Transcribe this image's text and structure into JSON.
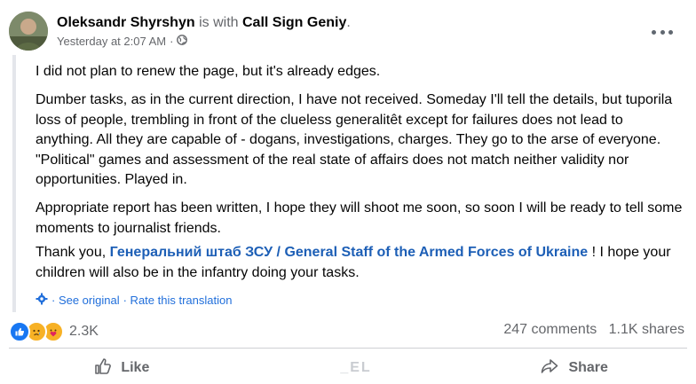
{
  "post": {
    "author": "Oleksandr Shyrshyn",
    "is_with": "is with",
    "tagged": "Call Sign Geniy",
    "period": ".",
    "timestamp": "Yesterday at 2:07 AM",
    "separator": "·",
    "paragraph_1": "I did not plan to renew the page, but it's already edges.",
    "paragraph_2": "Dumber tasks, as in the current direction, I have not received. Someday I'll tell the details, but tuporila loss of people, trembling in front of the clueless generalitêt except for failures does not lead to anything. All they are capable of - dogans, investigations, charges. They go to the arse of everyone. \"Political\" games and assessment of the real state of affairs does not match neither validity nor opportunities. Played in.",
    "paragraph_3": "Appropriate report has been written, I hope they will shoot me soon, so soon I will be ready to tell some moments to journalist friends.",
    "paragraph_4_before": "Thank you, ",
    "paragraph_4_link": "Генеральний штаб ЗСУ / General Staff of the Armed Forces of Ukraine",
    "paragraph_4_after": " ! I hope your children will also be in the infantry doing your tasks.",
    "see_original": "· See original",
    "rate_translation": "· Rate this translation"
  },
  "stats": {
    "reactions_count": "2.3K",
    "comments": "247 comments",
    "shares": "1.1K shares"
  },
  "actions": {
    "like": "Like",
    "center_watermark": " _EL",
    "share": "Share"
  },
  "colors": {
    "link": "#1d5fb6",
    "muted": "#65676b",
    "like_blue": "#1877f2"
  },
  "icons": [
    "globe-icon",
    "more-icon",
    "gear-icon",
    "like-reaction-icon",
    "sad-reaction-icon",
    "care-reaction-icon",
    "thumbs-up-icon",
    "share-arrow-icon"
  ]
}
